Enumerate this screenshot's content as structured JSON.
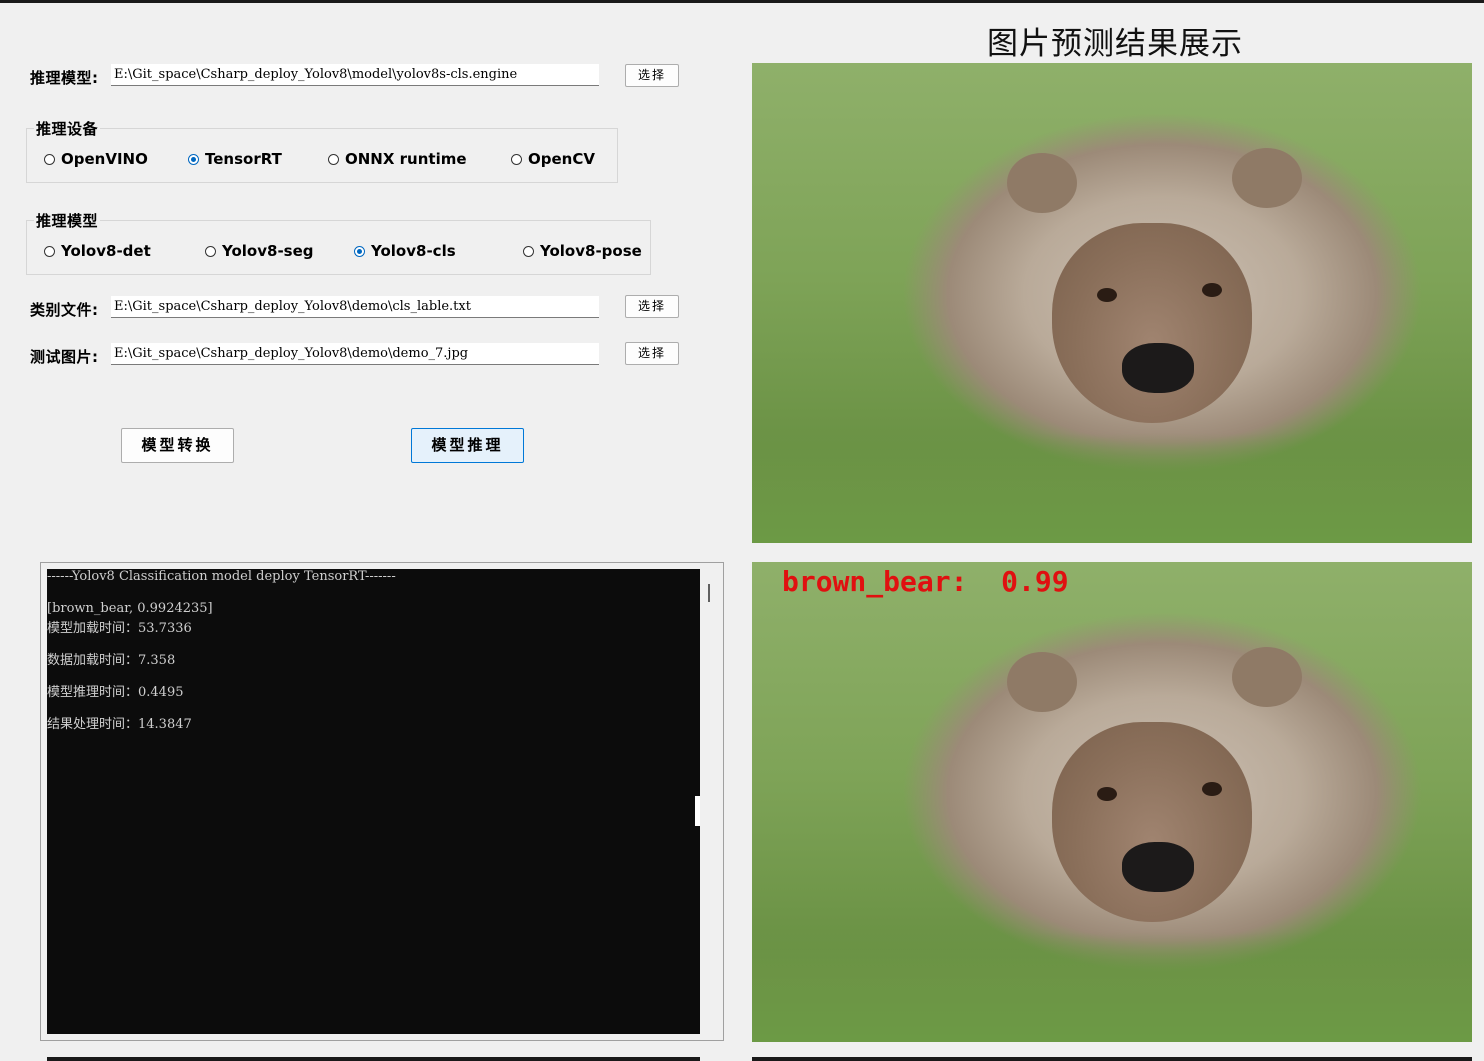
{
  "model_row": {
    "label": "推理模型:",
    "path": "E:\\Git_space\\Csharp_deploy_Yolov8\\model\\yolov8s-cls.engine",
    "button": "选择"
  },
  "device_group": {
    "title": "推理设备",
    "options": [
      {
        "label": "OpenVINO",
        "selected": false
      },
      {
        "label": "TensorRT",
        "selected": true
      },
      {
        "label": "ONNX runtime",
        "selected": false
      },
      {
        "label": "OpenCV",
        "selected": false
      }
    ]
  },
  "model_group": {
    "title": "推理模型",
    "options": [
      {
        "label": "Yolov8-det",
        "selected": false
      },
      {
        "label": "Yolov8-seg",
        "selected": false
      },
      {
        "label": "Yolov8-cls",
        "selected": true
      },
      {
        "label": "Yolov8-pose",
        "selected": false
      }
    ]
  },
  "class_row": {
    "label": "类别文件:",
    "path": "E:\\Git_space\\Csharp_deploy_Yolov8\\demo\\cls_lable.txt",
    "button": "选择"
  },
  "image_row": {
    "label": "测试图片:",
    "path": "E:\\Git_space\\Csharp_deploy_Yolov8\\demo\\demo_7.jpg",
    "button": "选择"
  },
  "actions": {
    "convert": "模型转换",
    "infer": "模型推理"
  },
  "console": {
    "lines": [
      "------Yolov8 Classification model deploy TensorRT-------",
      "[brown_bear, 0.9924235]",
      "模型加载时间：53.7336",
      "数据加载时间：7.358",
      "模型推理时间：0.4495",
      "结果处理时间：14.3847"
    ]
  },
  "display": {
    "title": "图片预测结果展示",
    "result_label": "brown_bear:  0.99"
  },
  "colors": {
    "accent": "#0067c0",
    "result_text": "#e01010",
    "console_bg": "#0c0c0c"
  }
}
